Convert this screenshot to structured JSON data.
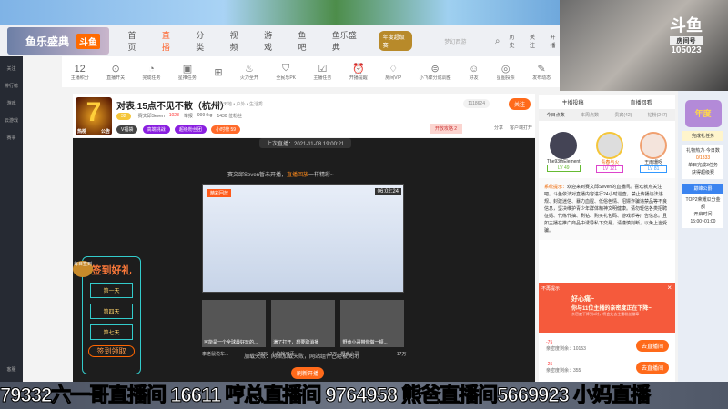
{
  "header": {
    "logo": "鱼乐盛典",
    "brand": "斗鱼",
    "nav": [
      "首页",
      "直播",
      "分类",
      "视频",
      "游戏",
      "鱼吧",
      "鱼乐盛典"
    ],
    "active": "直播",
    "promo": "年度超级赛",
    "search_placeholder": "梦幻西游",
    "icons": [
      "历史",
      "关注",
      "开播"
    ]
  },
  "sidebar": [
    "关注",
    "排行榜",
    "游戏",
    "云游戏",
    "赛事",
    "客服"
  ],
  "toolbar": {
    "score": "12",
    "score_label": "主播积分",
    "items": [
      "直播开关",
      "完成任务",
      "星推任务",
      "",
      "火力全开",
      "全民乐PK",
      "主播任务",
      "开播提醒",
      "房间VIP",
      "小飞碟分成调整",
      "好友",
      "星图投票",
      "发布动态"
    ]
  },
  "room": {
    "title": "对表,15点不见不散（杭州）",
    "category": "娱乐天地 • 户外 • 生活秀",
    "anchor": "赛文邱Seven",
    "hot": "1028",
    "report": "举报",
    "weight": "999+kg",
    "followers": "1430 位粉丝",
    "badge_lv": "32",
    "follow_count": "1118624",
    "follow": "关注",
    "tags": [
      "V福袋",
      "高端挑战",
      "超级粉丝团",
      "小时榜 59"
    ],
    "share": "分享",
    "client": "客户端打开",
    "avatar_labels": [
      "热榜",
      "公告"
    ],
    "rank_badge": "开放攻略 2"
  },
  "video": {
    "last_live": "上次直播：2021-11-08 19:00:21",
    "notice": "赛文邱Seven暂未开播，",
    "notice_link": "直播回放",
    "notice_tail": "一样精彩~",
    "replay_tag": "精彩回放",
    "duration": "06:02:24",
    "thumbs": [
      {
        "title": "可能是一个全球最好玩的...",
        "name": "李老鼠说车...",
        "views": "22万"
      },
      {
        "title": "满了打开，想要取消播",
        "name": "小约翰可汗",
        "views": "42万"
      },
      {
        "title": "野食小哥带你做一顿...",
        "name": "野食小哥",
        "views": "17万"
      }
    ],
    "error": "加载失败：网络加载失败，网站组件已经被关闭",
    "btn": "刷新开播",
    "signin": {
      "title": "签到好礼",
      "days": [
        "第一天",
        "第四天",
        "第七天"
      ],
      "cta": "签到领取",
      "badge": "每日签到"
    }
  },
  "right": {
    "tab_top": [
      "主播投稿",
      "直播回看"
    ],
    "tabs": [
      "今日点数",
      "本周点数",
      "贵宾(42)",
      "钻粉(247)"
    ],
    "ranks": [
      {
        "name": "The93thElement",
        "lv": "LV 49"
      },
      {
        "name": "青春与火",
        "lv": "LV 121"
      },
      {
        "name": "王雨珊呀",
        "lv": "LV 81"
      }
    ],
    "system_label": "系统提示：",
    "system": "欢迎来到赛文邱Seven的直播间。喜欢就点关注吧。斗鱼依法对直播内容进行24小时巡查，禁止传播违法违规、封建迷信、暴力血腥、低俗色情、招嫖诈骗违禁品等不良信息，坚决维护青少年群体精神文明健康。请勿轻信各类招聘征婚、代练代抽、刷钻、购买礼包码、游戏币等广告信息。且如主播在推广商品中诱导私下交易，请谨慎判断，以免上当受骗。",
    "popup_hide": "不再提示",
    "popup_title": "好心痛~",
    "popup_line": "你与11位主播的亲密度正在下降~",
    "popup_sub": "亲密度下降到0时，将会失去主播粉丝徽章",
    "fans": [
      {
        "delta": "-75",
        "remain": "亲密度剩余：10153",
        "btn": "去直播间"
      },
      {
        "delta": "-25",
        "remain": "亲密度剩余：355",
        "btn": "去直播间"
      }
    ]
  },
  "far": {
    "title": "年度",
    "task": "完成礼任务",
    "gift": "礼物热力·今日数",
    "progress": "0/1333",
    "link1": "单日完成3任务",
    "link2": "获得超级赛",
    "hot": "巅峰公爵",
    "top": "TOP2荣耀瓜分金额",
    "time_label": "开启时间",
    "time": "15:00~01:00"
  },
  "cam": {
    "brand": "斗鱼",
    "room_label": "房间号",
    "room": "105023"
  },
  "ticker": "79332六一哥直播间 16611 哼总直播间 9764958 熊爸直播间5669923 小妈直播"
}
